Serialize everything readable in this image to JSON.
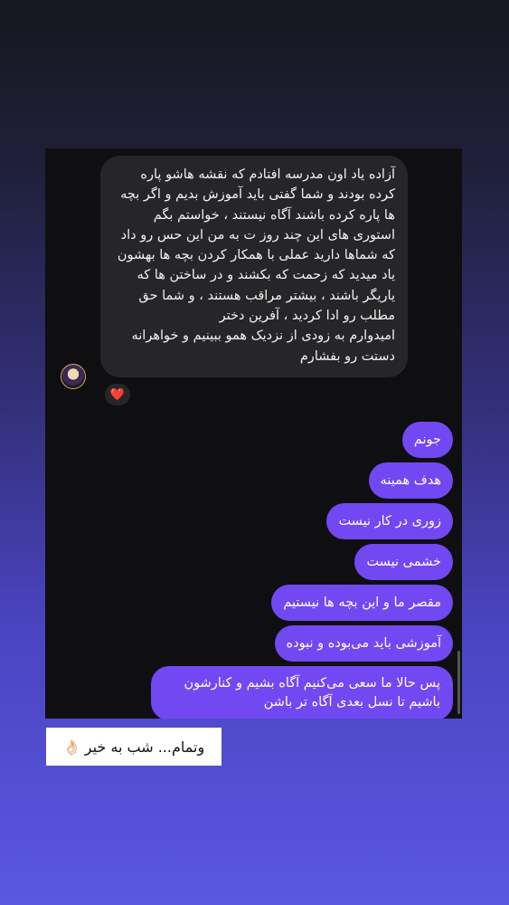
{
  "incoming_message": {
    "lines": [
      "آزاده یاد اون مدرسه افتادم که نقشه هاشو پاره کرده بودند و شما گفتی باید آموزش بدیم و اگر بچه ها پاره کرده باشند آگاه نیستند ، خواستم بگم استوری های این چند روز ت به من این حس رو داد که شماها دارید عملی با همکار کردن بچه ها بهشون یاد میدید که زحمت که بکشند و در ساختن ها که یاریگر باشند ، بیشتر مراقب هستند ، و شما حق مطلب رو ادا کردید ، آفرین دختر",
      "امیدوارم به زودی از نزدیک همو ببینیم و خواهرانه دستت رو بفشارم"
    ],
    "reaction": "❤️"
  },
  "outgoing_messages": [
    "جونم",
    "هدف همینه",
    "زوری در کار نیست",
    "خشمی نیست",
    "مقصر ما و این بچه ها نیستیم",
    "آموزشی باید می‌بوده و نبوده",
    "پس حالا ما سعی می‌کنیم آگاه بشیم و کنارشون باشیم تا نسل بعدی آگاه تر باشن"
  ],
  "caption": {
    "text": "وتمام... شب به خیر",
    "emoji": "👌🏻"
  },
  "colors": {
    "outgoing_bubble": "#7248f2",
    "incoming_bubble": "#262629",
    "chat_background": "#0f0f12"
  }
}
